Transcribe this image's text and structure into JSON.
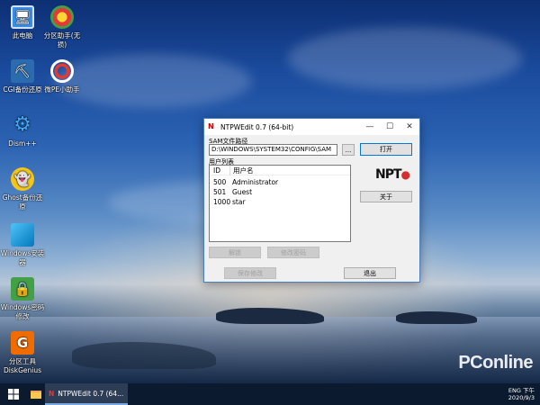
{
  "desktop": {
    "icons": [
      {
        "label": "此电脑",
        "icon": "computer-icon"
      },
      {
        "label": "分区助手(无损)",
        "icon": "partition-assistant-icon"
      },
      {
        "label": "CGI备份还原",
        "icon": "cgi-backup-icon"
      },
      {
        "label": "微PE小助手",
        "icon": "lifebuoy-icon"
      },
      {
        "label": "Dism++",
        "icon": "gears-icon"
      },
      {
        "label": "Ghost备份还原",
        "icon": "ghost-icon"
      },
      {
        "label": "Windows安装器",
        "icon": "windows-installer-icon"
      },
      {
        "label": "Windows密码修改",
        "icon": "padlock-icon"
      },
      {
        "label": "分区工具DiskGenius",
        "icon": "diskgenius-icon"
      }
    ]
  },
  "window": {
    "title": "NTPWEdit 0.7 (64-bit)",
    "sam_label": "SAM文件路径",
    "sam_path": "D:\\WINDOWS\\SYSTEM32\\CONFIG\\SAM",
    "browse_label": "...",
    "open_label": "打开",
    "user_list_label": "用户列表",
    "columns": {
      "id": "ID",
      "name": "用户名"
    },
    "users": [
      {
        "id": "500",
        "name": "Administrator"
      },
      {
        "id": "501",
        "name": "Guest"
      },
      {
        "id": "1000",
        "name": "star"
      }
    ],
    "logo_text": "NPT",
    "about_label": "关于",
    "unlock_label": "解锁",
    "change_password_label": "修改密码",
    "save_label": "保存修改",
    "exit_label": "退出"
  },
  "taskbar": {
    "active_item": "NTPWEdit 0.7 (64...",
    "clock_time": "下午",
    "clock_date": "2020/9/3",
    "ime": "ENG"
  },
  "watermark": "PConline",
  "colors": {
    "accent": "#0078d7",
    "taskbar": "#0b1a2e"
  }
}
